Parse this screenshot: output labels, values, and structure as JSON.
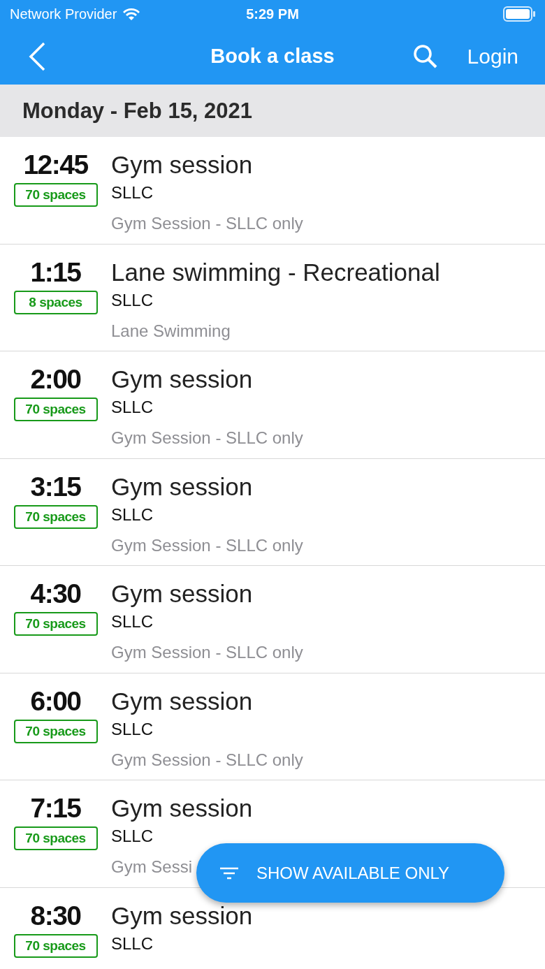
{
  "status_bar": {
    "carrier": "Network Provider",
    "time": "5:29 PM"
  },
  "nav": {
    "title": "Book a class",
    "login": "Login"
  },
  "date_header": "Monday - Feb 15, 2021",
  "sessions": [
    {
      "time": "12:45",
      "spaces": "70 spaces",
      "title": "Gym session",
      "location": "SLLC",
      "description": "Gym Session - SLLC only"
    },
    {
      "time": "1:15",
      "spaces": "8 spaces",
      "title": "Lane swimming - Recreational",
      "location": "SLLC",
      "description": "Lane Swimming"
    },
    {
      "time": "2:00",
      "spaces": "70 spaces",
      "title": "Gym session",
      "location": "SLLC",
      "description": "Gym Session - SLLC only"
    },
    {
      "time": "3:15",
      "spaces": "70 spaces",
      "title": "Gym session",
      "location": "SLLC",
      "description": "Gym Session - SLLC only"
    },
    {
      "time": "4:30",
      "spaces": "70 spaces",
      "title": "Gym session",
      "location": "SLLC",
      "description": "Gym Session - SLLC only"
    },
    {
      "time": "6:00",
      "spaces": "70 spaces",
      "title": "Gym session",
      "location": "SLLC",
      "description": "Gym Session - SLLC only"
    },
    {
      "time": "7:15",
      "spaces": "70 spaces",
      "title": "Gym session",
      "location": "SLLC",
      "description": "Gym Sessi"
    },
    {
      "time": "8:30",
      "spaces": "70 spaces",
      "title": "Gym session",
      "location": "SLLC"
    }
  ],
  "fab": {
    "label": "SHOW AVAILABLE ONLY"
  }
}
